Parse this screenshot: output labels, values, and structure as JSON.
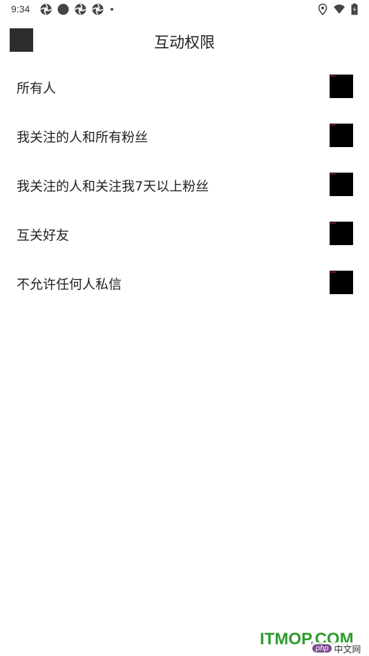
{
  "status_bar": {
    "time": "9:34",
    "left_icons": [
      "aperture-icon",
      "circle-icon",
      "aperture-icon",
      "aperture-icon",
      "dot-icon"
    ],
    "right_icons": [
      "location-icon",
      "wifi-icon",
      "battery-icon"
    ]
  },
  "header": {
    "title": "互动权限",
    "back_icon": "back-icon"
  },
  "options": [
    {
      "label": "所有人"
    },
    {
      "label": "我关注的人和所有粉丝"
    },
    {
      "label": "我关注的人和关注我7天以上粉丝"
    },
    {
      "label": "互关好友"
    },
    {
      "label": "不允许任何人私信"
    }
  ],
  "watermark": {
    "text": "ITMOP.COM",
    "badge_php": "php",
    "badge_cn": "中文网"
  }
}
